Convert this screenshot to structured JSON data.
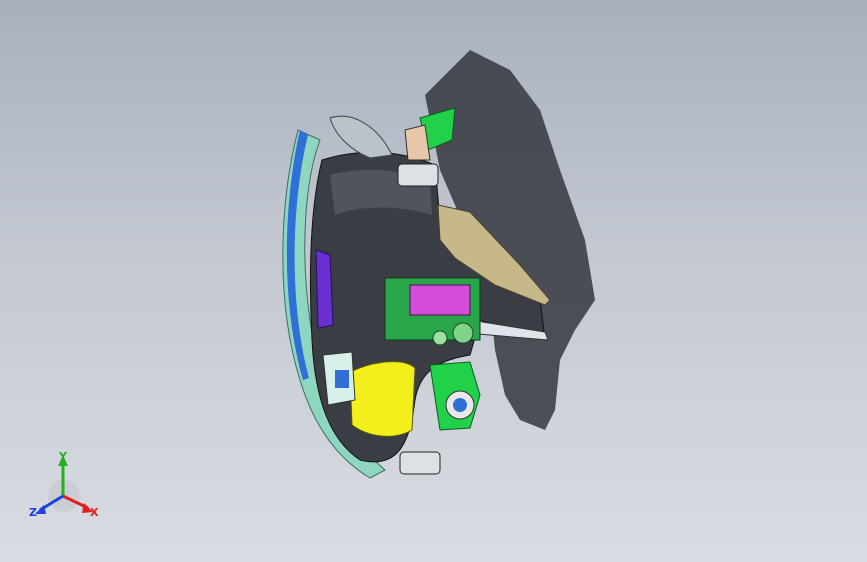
{
  "viewport": {
    "background_top": "#a9b0bd",
    "background_bottom": "#d9dce2"
  },
  "model": {
    "description_icon": "cad-assembly-model",
    "colors": {
      "body_dark": "#3a3d44",
      "trim_teal": "#8fd6c0",
      "lens_blue": "#2f6fd6",
      "green_part": "#22d14a",
      "yellow_part": "#f2ef1a",
      "magenta_part": "#d44bd8",
      "purple_part": "#6a2fd0",
      "shadow": "#2c2f36"
    }
  },
  "triad": {
    "x_label": "X",
    "y_label": "Y",
    "z_label": "Z",
    "x_color": "#e02020",
    "y_color": "#20b020",
    "z_color": "#2040e0"
  }
}
